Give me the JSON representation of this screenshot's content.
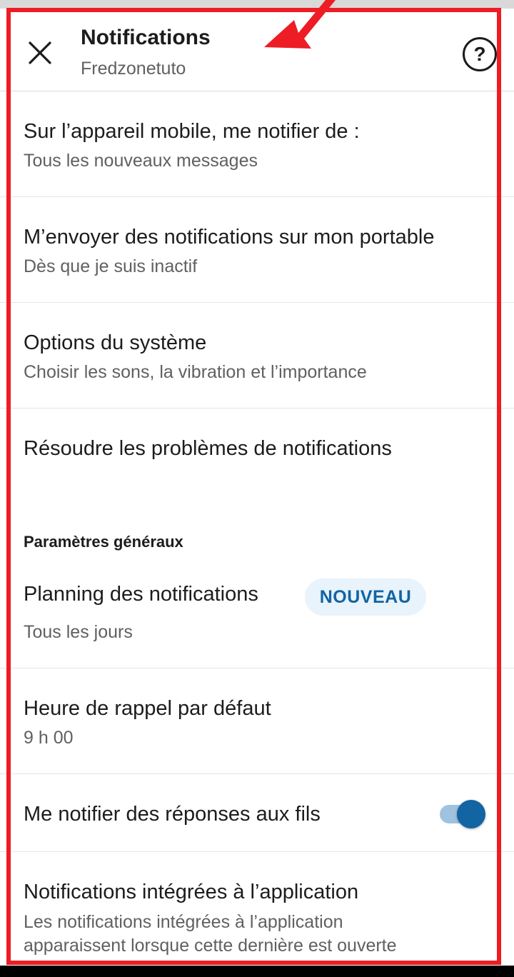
{
  "header": {
    "title": "Notifications",
    "subtitle": "Fredzonetuto",
    "close_icon": "close-icon",
    "help_icon": "help-icon",
    "help_glyph": "?"
  },
  "settings": [
    {
      "title": "Sur l’appareil mobile, me notifier de :",
      "subtitle": "Tous les nouveaux messages"
    },
    {
      "title": "M’envoyer des notifications sur mon portable",
      "subtitle": "Dès que je suis inactif"
    },
    {
      "title": "Options du système",
      "subtitle": "Choisir les sons, la vibration et l’importance"
    },
    {
      "title": "Résoudre les problèmes de notifications"
    }
  ],
  "general": {
    "section_title": "Paramètres généraux",
    "schedule": {
      "title": "Planning des notifications",
      "badge": "NOUVEAU",
      "subtitle": "Tous les jours"
    },
    "reminder": {
      "title": "Heure de rappel par défaut",
      "subtitle": "9 h 00"
    },
    "threads": {
      "title": "Me notifier des réponses aux fils",
      "toggle_on": true
    },
    "in_app": {
      "title": "Notifications intégrées à l’application",
      "subtitle_line1": "Les notifications intégrées à l’application",
      "subtitle_line2": "apparaissent lorsque cette dernière est ouverte"
    }
  },
  "annotation": {
    "highlight_color": "#ee1c24"
  },
  "colors": {
    "accent": "#1264a3",
    "badge_bg": "#e8f3fb",
    "text": "#1d1c1d",
    "muted": "#616061"
  }
}
